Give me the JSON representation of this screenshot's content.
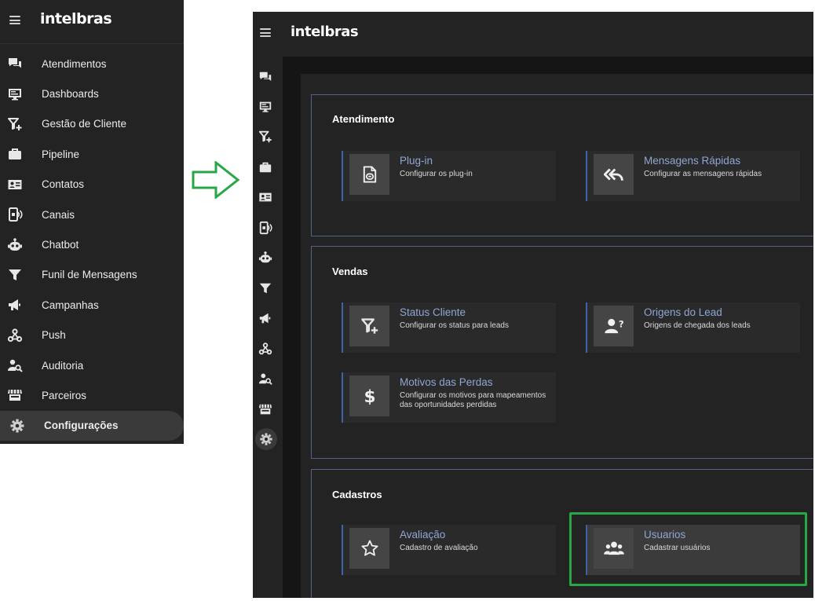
{
  "brand": {
    "name": "intelbras"
  },
  "sidebar": {
    "items": [
      {
        "label": "Atendimentos",
        "icon": "chat-icon"
      },
      {
        "label": "Dashboards",
        "icon": "monitor-icon"
      },
      {
        "label": "Gestão de Cliente",
        "icon": "filter-plus-icon"
      },
      {
        "label": "Pipeline",
        "icon": "briefcase-icon"
      },
      {
        "label": "Contatos",
        "icon": "contact-card-icon"
      },
      {
        "label": "Canais",
        "icon": "phone-signal-icon"
      },
      {
        "label": "Chatbot",
        "icon": "robot-icon"
      },
      {
        "label": "Funil de Mensagens",
        "icon": "funnel-icon"
      },
      {
        "label": "Campanhas",
        "icon": "megaphone-icon"
      },
      {
        "label": "Push",
        "icon": "webhook-icon"
      },
      {
        "label": "Auditoria",
        "icon": "user-search-icon"
      },
      {
        "label": "Parceiros",
        "icon": "store-icon"
      },
      {
        "label": "Configurações",
        "icon": "gear-icon",
        "active": true
      }
    ]
  },
  "sections": {
    "atendimento": {
      "title": "Atendimento",
      "cards": [
        {
          "title": "Plug-in",
          "desc": "Configurar os plug-in",
          "icon": "plugin-file-icon"
        },
        {
          "title": "Mensagens Rápidas",
          "desc": "Configurar as mensagens rápidas",
          "icon": "reply-all-icon"
        }
      ]
    },
    "vendas": {
      "title": "Vendas",
      "cards": [
        {
          "title": "Status Cliente",
          "desc": "Configurar os status para leads",
          "icon": "filter-plus-icon"
        },
        {
          "title": "Origens do Lead",
          "desc": "Origens de chegada dos leads",
          "icon": "user-question-icon"
        },
        {
          "title": "Motivos das Perdas",
          "desc": "Configurar os motivos para mapeamentos das oportunidades perdidas",
          "icon": "dollar-icon"
        }
      ]
    },
    "cadastros": {
      "title": "Cadastros",
      "cards": [
        {
          "title": "Avaliação",
          "desc": "Cadastro de avaliação",
          "icon": "star-icon"
        },
        {
          "title": "Usuarios",
          "desc": "Cadastrar usuários",
          "icon": "users-icon",
          "highlighted": true
        }
      ]
    }
  },
  "colors": {
    "sidebar_bg": "#232323",
    "content_bg": "#151515",
    "card_title": "#8fa6d4",
    "section_border": "#55638a",
    "highlight": "#27a745",
    "arrow": "#27a745"
  }
}
